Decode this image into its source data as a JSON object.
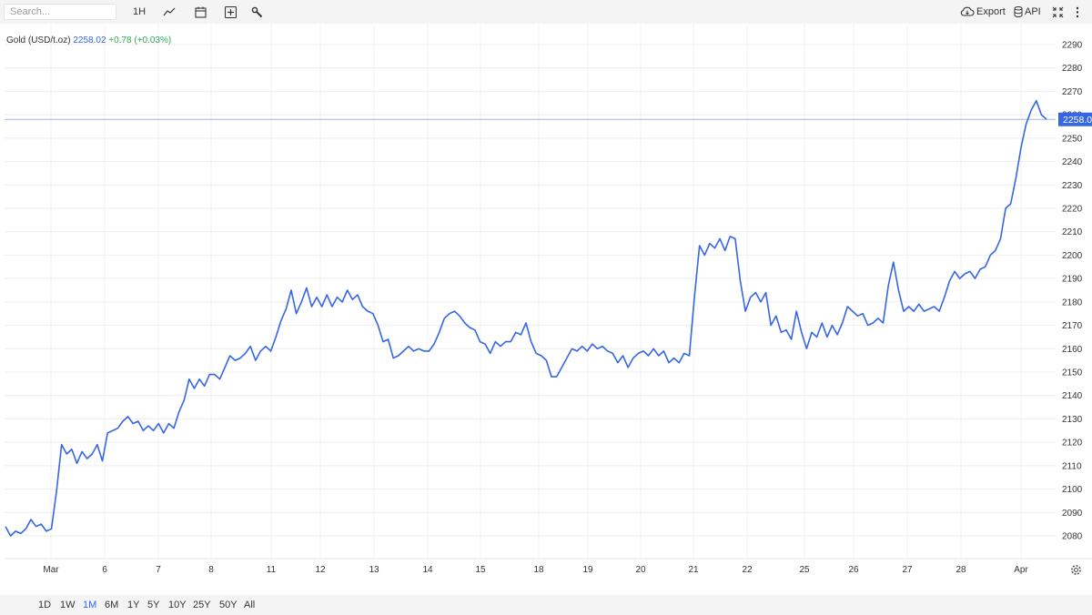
{
  "toolbar": {
    "search_placeholder": "Search...",
    "interval_label": "1H",
    "export_label": "Export",
    "api_label": "API",
    "icons": [
      "line-chart-icon",
      "calendar-icon",
      "add-indicator-icon",
      "wrench-icon",
      "cloud-download-icon",
      "database-icon",
      "collapse-icon",
      "more-vertical-icon"
    ]
  },
  "legend": {
    "symbol": "Gold (USD/t.oz)",
    "price": "2258.02",
    "change": "+0.78 (+0.03%)"
  },
  "ranges": [
    {
      "label": "1D",
      "active": false
    },
    {
      "label": "1W",
      "active": false
    },
    {
      "label": "1M",
      "active": true
    },
    {
      "label": "6M",
      "active": false
    },
    {
      "label": "1Y",
      "active": false
    },
    {
      "label": "5Y",
      "active": false
    },
    {
      "label": "10Y",
      "active": false
    },
    {
      "label": "25Y",
      "active": false
    },
    {
      "label": "50Y",
      "active": false
    },
    {
      "label": "All",
      "active": false
    }
  ],
  "colors": {
    "line": "#3466e6",
    "last_price_bg": "#3466e6",
    "positive": "#2fa84f",
    "active_range": "#3466e6"
  },
  "chart_data": {
    "type": "line",
    "title": "",
    "series": [
      {
        "name": "Gold (USD/t.oz)",
        "color": "#3466e6"
      }
    ],
    "y_ticks": [
      2080,
      2090,
      2100,
      2110,
      2120,
      2130,
      2140,
      2150,
      2160,
      2170,
      2180,
      2190,
      2200,
      2210,
      2220,
      2230,
      2240,
      2250,
      2260,
      2270,
      2280,
      2290
    ],
    "ylim": [
      2075,
      2295
    ],
    "x_ticks": [
      "Mar",
      "6",
      "7",
      "8",
      "11",
      "12",
      "13",
      "14",
      "15",
      "18",
      "19",
      "20",
      "21",
      "22",
      "25",
      "26",
      "27",
      "28",
      "Apr"
    ],
    "last_price_label": "2258.0",
    "last_price": 2258.02,
    "grid": true,
    "points": [
      [
        "Mar",
        2084
      ],
      [
        "Mar",
        2080
      ],
      [
        "Mar",
        2082
      ],
      [
        "Mar",
        2081
      ],
      [
        "Mar",
        2083
      ],
      [
        "Mar",
        2087
      ],
      [
        "Mar",
        2084
      ],
      [
        "Mar",
        2085
      ],
      [
        "Mar",
        2082
      ],
      [
        "Mar",
        2083
      ],
      [
        "Mar",
        2099
      ],
      [
        "Mar",
        2119
      ],
      [
        "Mar",
        2115
      ],
      [
        "Mar",
        2117
      ],
      [
        "Mar",
        2111
      ],
      [
        "Mar",
        2116
      ],
      [
        "Mar",
        2113
      ],
      [
        "Mar",
        2115
      ],
      [
        "Mar",
        2119
      ],
      [
        "Mar",
        2112
      ],
      [
        "Mar",
        2124
      ],
      [
        "Mar",
        2125
      ],
      [
        "Mar",
        2126
      ],
      [
        "Mar",
        2129
      ],
      [
        "Mar",
        2131
      ],
      [
        "6",
        2128
      ],
      [
        "6",
        2129
      ],
      [
        "6",
        2125
      ],
      [
        "6",
        2127
      ],
      [
        "6",
        2125
      ],
      [
        "6",
        2128
      ],
      [
        "6",
        2124
      ],
      [
        "6",
        2128
      ],
      [
        "6",
        2126
      ],
      [
        "6",
        2133
      ],
      [
        "7",
        2138
      ],
      [
        "7",
        2147
      ],
      [
        "7",
        2143
      ],
      [
        "7",
        2147
      ],
      [
        "7",
        2144
      ],
      [
        "7",
        2149
      ],
      [
        "7",
        2149
      ],
      [
        "7",
        2147
      ],
      [
        "7",
        2152
      ],
      [
        "7",
        2157
      ],
      [
        "8",
        2155
      ],
      [
        "8",
        2156
      ],
      [
        "8",
        2158
      ],
      [
        "8",
        2161
      ],
      [
        "8",
        2155
      ],
      [
        "8",
        2159
      ],
      [
        "8",
        2161
      ],
      [
        "8",
        2159
      ],
      [
        "8",
        2165
      ],
      [
        "8",
        2172
      ],
      [
        "11",
        2177
      ],
      [
        "11",
        2185
      ],
      [
        "11",
        2175
      ],
      [
        "11",
        2180
      ],
      [
        "11",
        2186
      ],
      [
        "11",
        2178
      ],
      [
        "11",
        2182
      ],
      [
        "11",
        2178
      ],
      [
        "11",
        2183
      ],
      [
        "11",
        2178
      ],
      [
        "12",
        2182
      ],
      [
        "12",
        2180
      ],
      [
        "12",
        2185
      ],
      [
        "12",
        2181
      ],
      [
        "12",
        2183
      ],
      [
        "12",
        2178
      ],
      [
        "12",
        2176
      ],
      [
        "12",
        2175
      ],
      [
        "12",
        2170
      ],
      [
        "12",
        2163
      ],
      [
        "13",
        2164
      ],
      [
        "13",
        2156
      ],
      [
        "13",
        2157
      ],
      [
        "13",
        2159
      ],
      [
        "13",
        2161
      ],
      [
        "13",
        2159
      ],
      [
        "13",
        2160
      ],
      [
        "13",
        2159
      ],
      [
        "13",
        2159
      ],
      [
        "13",
        2162
      ],
      [
        "14",
        2167
      ],
      [
        "14",
        2173
      ],
      [
        "14",
        2175
      ],
      [
        "14",
        2176
      ],
      [
        "14",
        2174
      ],
      [
        "14",
        2171
      ],
      [
        "14",
        2169
      ],
      [
        "14",
        2168
      ],
      [
        "14",
        2163
      ],
      [
        "14",
        2162
      ],
      [
        "15",
        2158
      ],
      [
        "15",
        2163
      ],
      [
        "15",
        2161
      ],
      [
        "15",
        2163
      ],
      [
        "15",
        2163
      ],
      [
        "15",
        2167
      ],
      [
        "15",
        2166
      ],
      [
        "15",
        2171
      ],
      [
        "15",
        2163
      ],
      [
        "15",
        2158
      ],
      [
        "18",
        2157
      ],
      [
        "18",
        2155
      ],
      [
        "18",
        2148
      ],
      [
        "18",
        2148
      ],
      [
        "18",
        2152
      ],
      [
        "18",
        2156
      ],
      [
        "18",
        2160
      ],
      [
        "18",
        2159
      ],
      [
        "18",
        2161
      ],
      [
        "18",
        2159
      ],
      [
        "19",
        2162
      ],
      [
        "19",
        2160
      ],
      [
        "19",
        2161
      ],
      [
        "19",
        2159
      ],
      [
        "19",
        2158
      ],
      [
        "19",
        2154
      ],
      [
        "19",
        2157
      ],
      [
        "19",
        2152
      ],
      [
        "19",
        2156
      ],
      [
        "19",
        2158
      ],
      [
        "20",
        2159
      ],
      [
        "20",
        2157
      ],
      [
        "20",
        2160
      ],
      [
        "20",
        2157
      ],
      [
        "20",
        2159
      ],
      [
        "20",
        2154
      ],
      [
        "20",
        2156
      ],
      [
        "20",
        2154
      ],
      [
        "20",
        2158
      ],
      [
        "20",
        2157
      ],
      [
        "21",
        2182
      ],
      [
        "21",
        2204
      ],
      [
        "21",
        2200
      ],
      [
        "21",
        2205
      ],
      [
        "21",
        2203
      ],
      [
        "21",
        2207
      ],
      [
        "21",
        2202
      ],
      [
        "21",
        2208
      ],
      [
        "21",
        2207
      ],
      [
        "21",
        2189
      ],
      [
        "22",
        2176
      ],
      [
        "22",
        2182
      ],
      [
        "22",
        2184
      ],
      [
        "22",
        2180
      ],
      [
        "22",
        2184
      ],
      [
        "22",
        2170
      ],
      [
        "22",
        2174
      ],
      [
        "22",
        2167
      ],
      [
        "22",
        2168
      ],
      [
        "22",
        2164
      ],
      [
        "25",
        2176
      ],
      [
        "25",
        2167
      ],
      [
        "25",
        2160
      ],
      [
        "25",
        2167
      ],
      [
        "25",
        2165
      ],
      [
        "25",
        2171
      ],
      [
        "25",
        2165
      ],
      [
        "25",
        2170
      ],
      [
        "25",
        2166
      ],
      [
        "25",
        2171
      ],
      [
        "26",
        2178
      ],
      [
        "26",
        2176
      ],
      [
        "26",
        2174
      ],
      [
        "26",
        2175
      ],
      [
        "26",
        2170
      ],
      [
        "26",
        2171
      ],
      [
        "26",
        2173
      ],
      [
        "26",
        2171
      ],
      [
        "26",
        2187
      ],
      [
        "26",
        2197
      ],
      [
        "27",
        2185
      ],
      [
        "27",
        2176
      ],
      [
        "27",
        2178
      ],
      [
        "27",
        2176
      ],
      [
        "27",
        2179
      ],
      [
        "27",
        2176
      ],
      [
        "27",
        2177
      ],
      [
        "27",
        2178
      ],
      [
        "27",
        2176
      ],
      [
        "27",
        2182
      ],
      [
        "28",
        2189
      ],
      [
        "28",
        2193
      ],
      [
        "28",
        2190
      ],
      [
        "28",
        2192
      ],
      [
        "28",
        2193
      ],
      [
        "28",
        2190
      ],
      [
        "28",
        2194
      ],
      [
        "28",
        2195
      ],
      [
        "28",
        2200
      ],
      [
        "28",
        2202
      ],
      [
        "Apr",
        2207
      ],
      [
        "Apr",
        2220
      ],
      [
        "Apr",
        2222
      ],
      [
        "Apr",
        2233
      ],
      [
        "Apr",
        2246
      ],
      [
        "Apr",
        2256
      ],
      [
        "Apr",
        2262
      ],
      [
        "Apr",
        2266
      ],
      [
        "Apr",
        2260
      ],
      [
        "Apr",
        2258.02
      ]
    ]
  }
}
